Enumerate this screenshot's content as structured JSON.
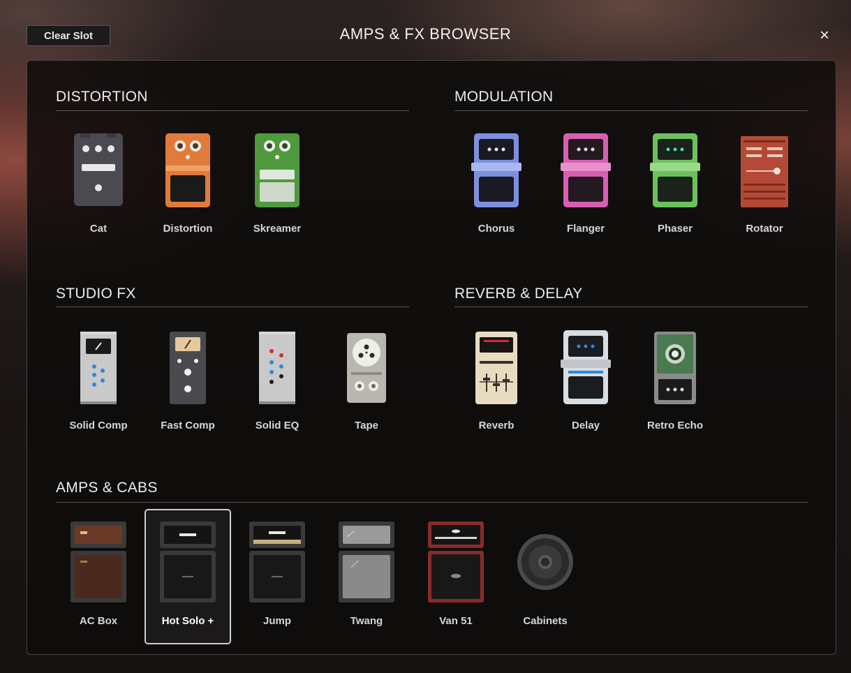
{
  "window": {
    "title": "AMPS & FX BROWSER",
    "clear_label": "Clear Slot",
    "close_glyph": "×"
  },
  "sections": {
    "distortion": {
      "title": "DISTORTION",
      "items": [
        {
          "label": "Cat",
          "icon": "cat-pedal-icon",
          "color": "#4a4a50"
        },
        {
          "label": "Distortion",
          "icon": "distortion-pedal-icon",
          "color": "#e07b3a"
        },
        {
          "label": "Skreamer",
          "icon": "skreamer-pedal-icon",
          "color": "#4e9a3c"
        }
      ]
    },
    "modulation": {
      "title": "MODULATION",
      "items": [
        {
          "label": "Chorus",
          "icon": "chorus-pedal-icon",
          "color": "#7d8fe0"
        },
        {
          "label": "Flanger",
          "icon": "flanger-pedal-icon",
          "color": "#d85fb0"
        },
        {
          "label": "Phaser",
          "icon": "phaser-pedal-icon",
          "color": "#6cc25a"
        },
        {
          "label": "Rotator",
          "icon": "rotator-icon",
          "color": "#b34a36"
        }
      ]
    },
    "studio_fx": {
      "title": "STUDIO FX",
      "items": [
        {
          "label": "Solid Comp",
          "icon": "solid-comp-icon",
          "color": "#c9c9c9"
        },
        {
          "label": "Fast Comp",
          "icon": "fast-comp-icon",
          "color": "#4a4a4e"
        },
        {
          "label": "Solid EQ",
          "icon": "solid-eq-icon",
          "color": "#c9c9c9"
        },
        {
          "label": "Tape",
          "icon": "tape-icon",
          "color": "#b8b8b0"
        }
      ]
    },
    "reverb_delay": {
      "title": "REVERB & DELAY",
      "items": [
        {
          "label": "Reverb",
          "icon": "reverb-icon",
          "color": "#e8dcc0"
        },
        {
          "label": "Delay",
          "icon": "delay-pedal-icon",
          "color": "#d8dde2"
        },
        {
          "label": "Retro Echo",
          "icon": "retro-echo-icon",
          "color": "#5a6a60"
        }
      ]
    },
    "amps_cabs": {
      "title": "AMPS & CABS",
      "selected": "Hot Solo +",
      "items": [
        {
          "label": "AC Box",
          "icon": "ac-box-amp-icon",
          "color": "#6a3a28"
        },
        {
          "label": "Hot Solo +",
          "icon": "hot-solo-amp-icon",
          "color": "#2a2a2a"
        },
        {
          "label": "Jump",
          "icon": "jump-amp-icon",
          "color": "#c8b080"
        },
        {
          "label": "Twang",
          "icon": "twang-amp-icon",
          "color": "#9a9a9a"
        },
        {
          "label": "Van 51",
          "icon": "van-51-amp-icon",
          "color": "#8a2a2a"
        },
        {
          "label": "Cabinets",
          "icon": "cabinets-speaker-icon",
          "color": "#3a3a3a"
        }
      ]
    }
  }
}
